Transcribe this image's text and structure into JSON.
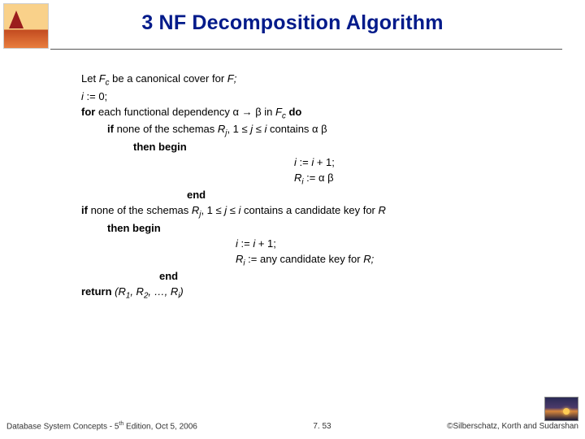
{
  "title": "3 NF Decomposition Algorithm",
  "lines": {
    "l1a": "Let ",
    "l1b": "F",
    "l1c": "c",
    "l1d": " be a canonical cover for ",
    "l1e": "F;",
    "l2a": "i",
    "l2b": " := 0;",
    "l3a": "for ",
    "l3b": "each  functional dependency α → β in ",
    "l3c": "F",
    "l3d": "c",
    "l3e": " do",
    "l4a": "if ",
    "l4b": "none of the schemas ",
    "l4c": "R",
    "l4d": "j",
    "l4e": ", 1 ≤ ",
    "l4f": "j",
    "l4g": " ≤ ",
    "l4h": "i",
    "l4i": " contains  α β",
    "l5": "then begin",
    "l6a": "i",
    "l6b": " := ",
    "l6c": "i",
    "l6d": "  + 1;",
    "l7a": "R",
    "l7b": "i",
    "l7c": "  := α β",
    "l8": "end",
    "l9a": "if ",
    "l9b": "none of the schemas ",
    "l9c": "R",
    "l9d": "j",
    "l9e": ", 1 ≤ ",
    "l9f": "j",
    "l9g": " ≤ ",
    "l9h": "i",
    "l9i": " contains a candidate key for ",
    "l9j": "R",
    "l10": "then begin",
    "l11a": "i",
    "l11b": " := ",
    "l11c": "i",
    "l11d": "  + 1;",
    "l12a": "R",
    "l12b": "i",
    "l12c": " := any candidate key for ",
    "l12d": "R;",
    "l13": "end",
    "l14a": "return ",
    "l14b": "(R",
    "l14c": "1",
    "l14d": ", R",
    "l14e": "2",
    "l14f": ", …, R",
    "l14g": "i",
    "l14h": ")"
  },
  "footer": {
    "left_a": "Database System Concepts - 5",
    "left_b": "th",
    "left_c": " Edition, Oct 5, 2006",
    "mid": "7. 53",
    "right": "©Silberschatz, Korth and Sudarshan"
  }
}
